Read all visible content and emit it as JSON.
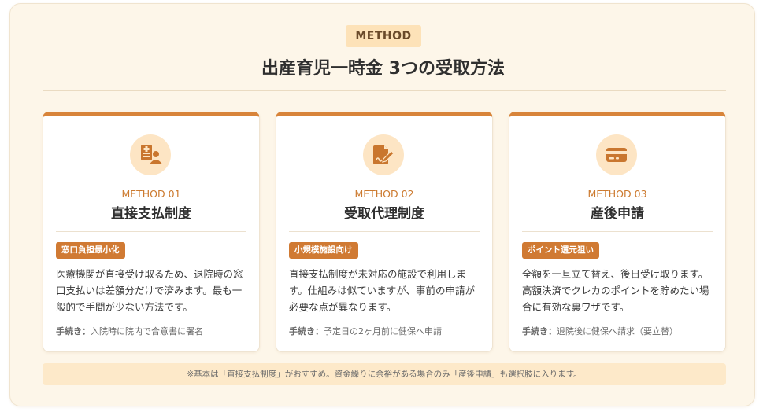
{
  "header": {
    "badge": "METHOD",
    "title": "出産育児一時金 3つの受取方法"
  },
  "cards": [
    {
      "icon": "document-person-icon",
      "number": "METHOD 01",
      "title": "直接支払制度",
      "tag": "窓口負担最小化",
      "description": "医療機関が直接受け取るため、退院時の窓口支払いは差額分だけで済みます。最も一般的で手間が少ない方法です。",
      "procedure_label": "手続き：",
      "procedure": "入院時に院内で合意書に署名"
    },
    {
      "icon": "document-signature-icon",
      "number": "METHOD 02",
      "title": "受取代理制度",
      "tag": "小規模施設向け",
      "description": "直接支払制度が未対応の施設で利用します。仕組みは似ていますが、事前の申請が必要な点が異なります。",
      "procedure_label": "手続き：",
      "procedure": "予定日の2ヶ月前に健保へ申請"
    },
    {
      "icon": "credit-card-icon",
      "number": "METHOD 03",
      "title": "産後申請",
      "tag": "ポイント還元狙い",
      "description": "全額を一旦立て替え、後日受け取ります。高額決済でクレカのポイントを貯めたい場合に有効な裏ワザです。",
      "procedure_label": "手続き：",
      "procedure": "退院後に健保へ請求（要立替）"
    }
  ],
  "footnote": "※基本は「直接支払制度」がおすすめ。資金繰りに余裕がある場合のみ「産後申請」も選択肢に入ります。",
  "colors": {
    "accent": "#d8843a",
    "tag_bg": "#d07a33",
    "badge_bg": "#fde2b8",
    "panel_bg": "#fdf6e9",
    "icon_bg": "#fde5c4"
  }
}
